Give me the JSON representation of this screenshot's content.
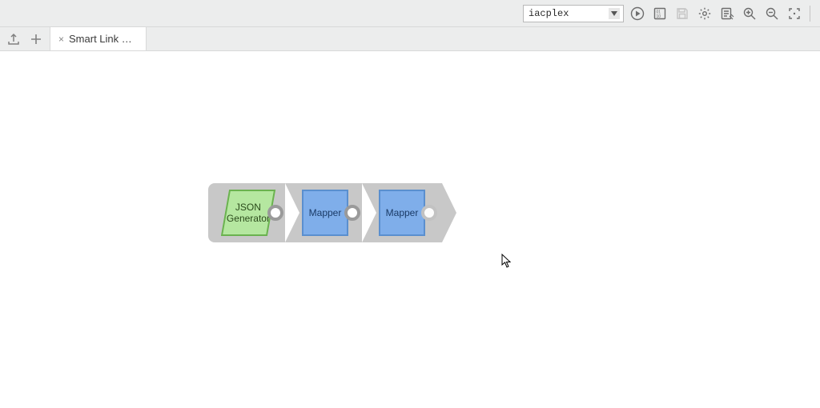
{
  "toolbar": {
    "dropdown": {
      "value": "iacplex"
    }
  },
  "tabs": [
    {
      "label": "Smart Link D…"
    }
  ],
  "pipeline": {
    "nodes": [
      {
        "label": "JSON Generator",
        "type": "green"
      },
      {
        "label": "Mapper",
        "type": "blue"
      },
      {
        "label": "Mapper",
        "type": "blue"
      }
    ]
  }
}
